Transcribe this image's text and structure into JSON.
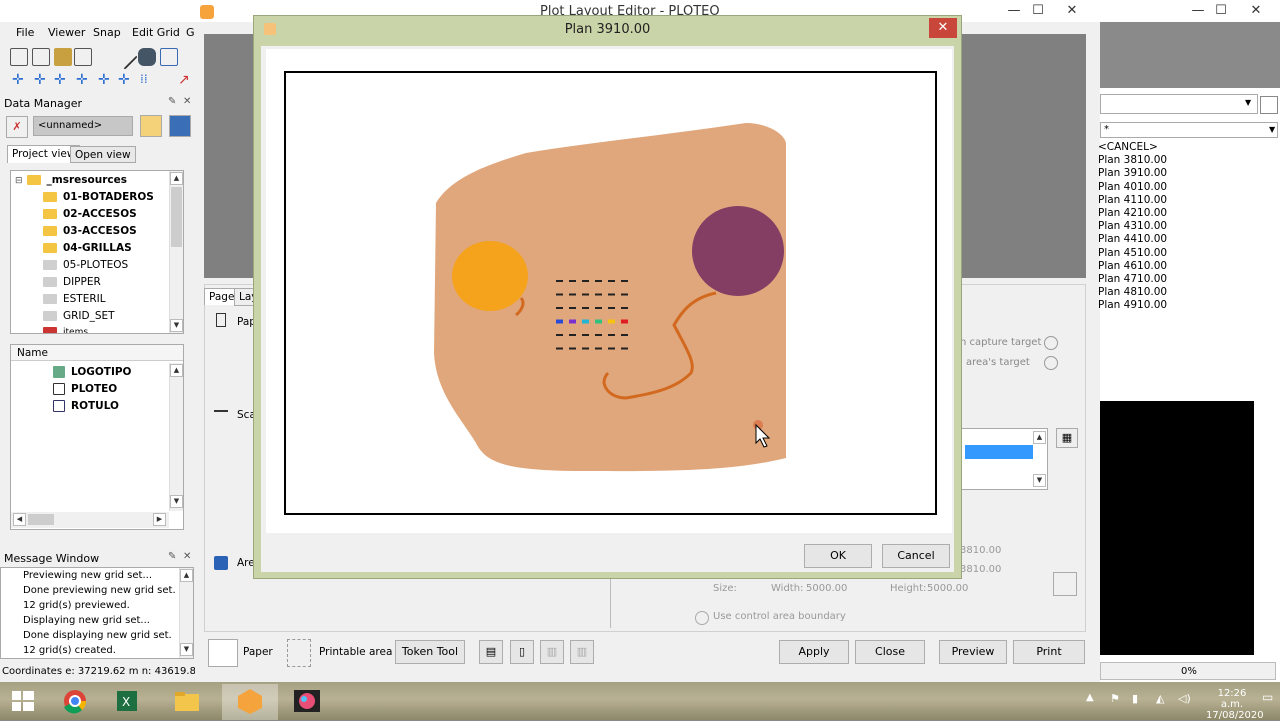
{
  "window": {
    "title": "Plot Layout Editor - PLOTEO",
    "minimize": "—",
    "maximize": "☐",
    "close": "✕"
  },
  "menu": [
    "File",
    "Viewer",
    "Snap",
    "Edit Grid",
    "G"
  ],
  "data_manager": {
    "title": "Data Manager",
    "project_name": "<unnamed>",
    "tabs": [
      "Project view",
      "Open view"
    ],
    "tree": [
      {
        "label": "_msresources",
        "type": "root"
      },
      {
        "label": "01-BOTADEROS",
        "type": "folder"
      },
      {
        "label": "02-ACCESOS",
        "type": "folder"
      },
      {
        "label": "03-ACCESOS",
        "type": "folder"
      },
      {
        "label": "04-GRILLAS",
        "type": "folder"
      },
      {
        "label": "05-PLOTEOS",
        "type": "folder-grey"
      },
      {
        "label": "DIPPER",
        "type": "folder-grey"
      },
      {
        "label": "ESTERIL",
        "type": "folder-grey"
      },
      {
        "label": "GRID_SET",
        "type": "folder-grey"
      },
      {
        "label": "items",
        "type": "partial"
      }
    ],
    "name_header": "Name",
    "files": [
      {
        "label": "LOGOTIPO",
        "icon": "logo-file-icon"
      },
      {
        "label": "PLOTEO",
        "icon": "plot-file-icon"
      },
      {
        "label": "ROTULO",
        "icon": "title-file-icon"
      }
    ]
  },
  "message_window": {
    "title": "Message Window",
    "lines": [
      "Previewing new grid set...",
      "Done previewing new grid set.",
      "12 grid(s) previewed.",
      "Displaying new grid set...",
      "Done displaying new grid set.",
      "12 grid(s) created."
    ]
  },
  "status": {
    "coordinates": "Coordinates  e: 37219.62 m  n: 43619.82"
  },
  "editor": {
    "tabs": [
      "Page",
      "Lay"
    ],
    "page_label": "Pap",
    "scale_label": "Sca",
    "area_label": "Are",
    "capture_target": "n capture target",
    "areas_target": "l area's target",
    "coord1": "3810.00",
    "coord2": "3810.00",
    "size_label": "Size:",
    "width_label": "Width:",
    "width_value": "5000.00",
    "height_label": "Height:",
    "height_value": "5000.00",
    "use_control_area": "Use control area boundary",
    "paper_label": "Paper",
    "printable_area_label": "Printable area",
    "token_tool": "Token Tool",
    "apply": "Apply",
    "close": "Close",
    "preview": "Preview",
    "print": "Print"
  },
  "right_panel": {
    "filter_value": "*",
    "items": [
      "<CANCEL>",
      "Plan 3810.00",
      "Plan 3910.00",
      "Plan 4010.00",
      "Plan 4110.00",
      "Plan 4210.00",
      "Plan 4310.00",
      "Plan 4410.00",
      "Plan 4510.00",
      "Plan 4610.00",
      "Plan 4710.00",
      "Plan 4810.00",
      "Plan 4910.00"
    ],
    "progress": "0%"
  },
  "dialog": {
    "title": "Plan 3910.00",
    "ok": "OK",
    "cancel": "Cancel"
  },
  "taskbar": {
    "time": "12:26 a.m.",
    "date": "17/08/2020",
    "apps": [
      "windows-start-icon",
      "chrome-icon",
      "excel-icon",
      "file-explorer-icon",
      "minesight-icon",
      "paint-icon"
    ]
  },
  "colors": {
    "pit_fill": "#e0a77c",
    "orange_blob": "#f5a21d",
    "purple_blob": "#843e64",
    "road": "#d2691e",
    "dialog_frame": "#c9d4a8",
    "selection": "#3399ff"
  }
}
